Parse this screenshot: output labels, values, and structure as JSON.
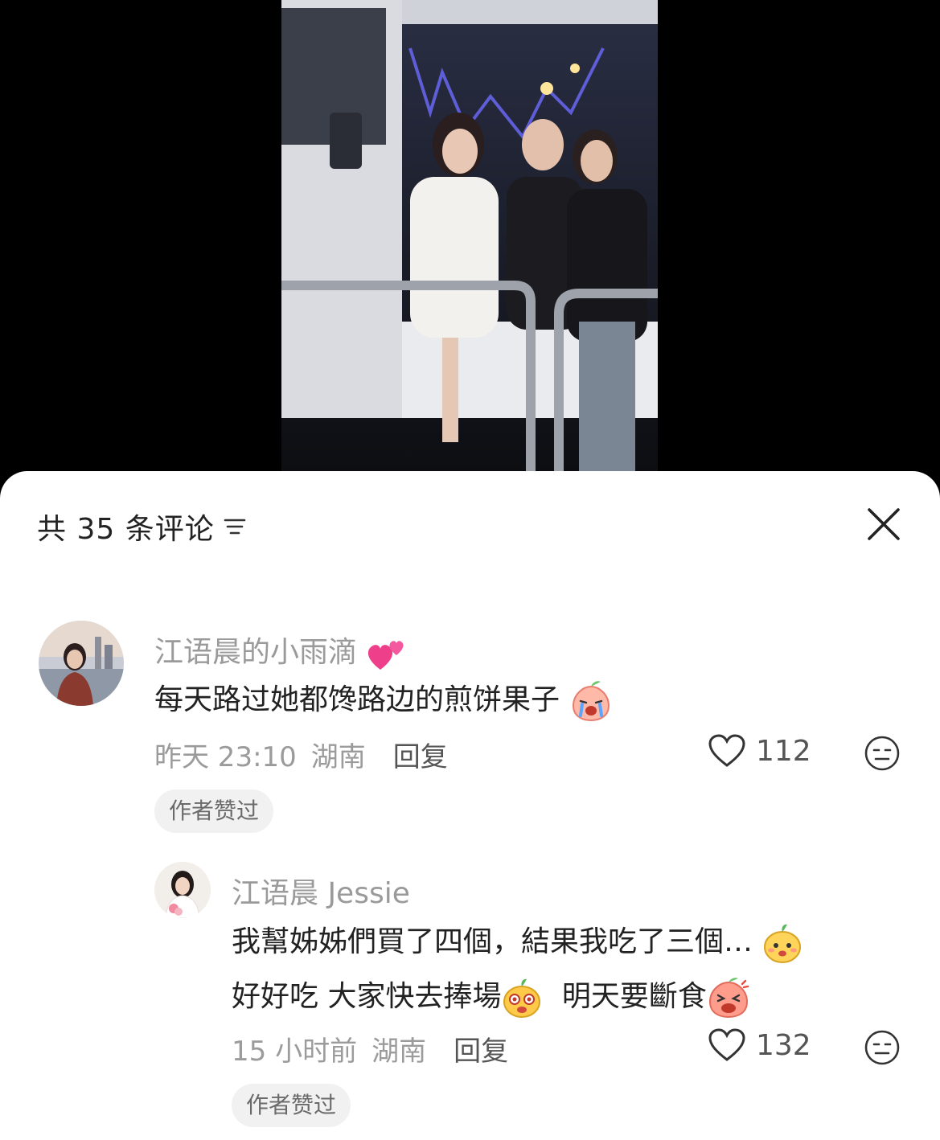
{
  "header": {
    "title": "共 35 条评论"
  },
  "comments": [
    {
      "username": "江语晨的小雨滴",
      "username_emoji": "two-hearts-emoji",
      "text": "每天路过她都馋路边的煎饼果子",
      "text_emoji": "crying-peach-emoji",
      "time": "昨天 23:10",
      "location": "湖南",
      "reply_label": "回复",
      "likes": "112",
      "badge": "作者赞过"
    },
    {
      "username": "江语晨 Jessie",
      "text_line1": "我幫姊姊們買了四個，結果我吃了三個…",
      "text_line2a": "好好吃 大家快去捧場",
      "text_line2b": "明天要斷食",
      "time": "15 小时前",
      "location": "湖南",
      "reply_label": "回复",
      "likes": "132",
      "badge": "作者赞过"
    }
  ],
  "colors": {
    "sheet_bg": "#ffffff",
    "username": "#9a9a9a",
    "text": "#222222",
    "badge_bg": "#f1f1f1"
  }
}
